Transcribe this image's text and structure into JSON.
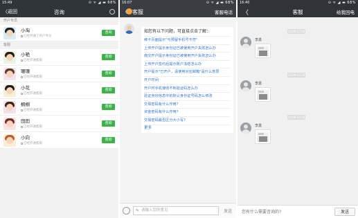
{
  "screen1": {
    "status": {
      "time": "15:49",
      "right": "⊙ ᯤ ◢ ▬ 68%"
    },
    "nav": {
      "back": "〈返回",
      "title": "咨询"
    },
    "section_top": "开户专员",
    "section_service": "客服",
    "consult_label": "咨询",
    "contacts": [
      {
        "name": "小淘",
        "sub": "已经开通了开户专员"
      },
      {
        "name": "小艳",
        "sub": "已经开通客服"
      },
      {
        "name": "珊珊",
        "sub": "已经开通客服"
      },
      {
        "name": "小花",
        "sub": "已经开通客服"
      },
      {
        "name": "桐桐",
        "sub": "已经开通客服"
      },
      {
        "name": "田田",
        "sub": "已经开通客服"
      },
      {
        "name": "小向",
        "sub": "已经开通客服"
      }
    ]
  },
  "screen2": {
    "status": {
      "time": "16:07",
      "right": "⊙ ᯤ ◢ ▬ 68%"
    },
    "nav": {
      "back": "〈",
      "title": "客服",
      "right": "客服电话"
    },
    "intro": "如您有以下问题，可直接点击了解：",
    "questions": [
      "绑卡页面提示\"与预留手机号不符\"",
      "上传开户提示身份证已被使用开户失败怎么办",
      "南交开户提示身份证已被使用开户失败怎么办",
      "上传开户签约后提示账户冻结怎么办",
      "开户提示\"已开户，请使用对应邮箱\"是什么意思",
      "开户时间",
      "开户时手机接收不到验证码怎么办",
      "验证身份信息中的默认身份证号码怎么修改",
      "交易密码有什么作用?",
      "资金密码有什么作用?",
      "交易密码最否区分大小写?"
    ],
    "more": "更多",
    "input_placeholder": "请输入您的意见",
    "send_label": "发送"
  },
  "screen3": {
    "status": {
      "time": "16:40",
      "right": "⊙ ᯤ ◢ ▬ 68%"
    },
    "nav": {
      "back": "〈",
      "title": "客服",
      "right": "给我回电"
    },
    "messages": [
      {
        "timestamp": "16:09:15:58",
        "user": "李勇"
      },
      {
        "timestamp": "16:09:15:58",
        "user": "李勇"
      },
      {
        "timestamp": "16:09:15:58",
        "user": "李勇"
      }
    ],
    "input_placeholder": "您有什么需要咨询的?",
    "send_label": "发送"
  },
  "colors": {
    "consult_green": "#3cb34a",
    "link_blue": "#2f78c8",
    "nav_dark": "#30353c"
  }
}
